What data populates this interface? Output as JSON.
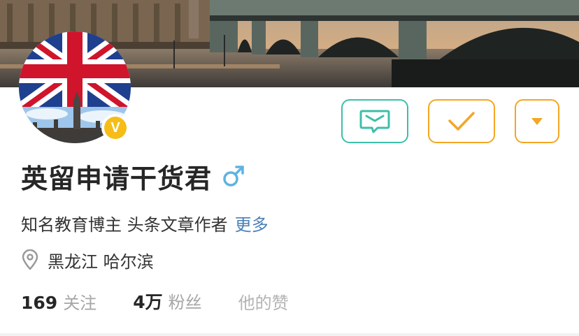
{
  "profile": {
    "name": "英留申请干货君",
    "gender_icon": "male-icon",
    "verified_badge": "V",
    "bio": "知名教育博主 头条文章作者",
    "bio_more": "更多",
    "location": "黑龙江 哈尔滨"
  },
  "stats": {
    "following_count": "169",
    "following_label": "关注",
    "fans_count": "4万",
    "fans_label": "粉丝",
    "likes_label": "他的赞"
  },
  "actions": {
    "message_icon": "message-icon",
    "follow_icon": "checkmark-icon",
    "more_icon": "caret-down-icon"
  },
  "colors": {
    "message_accent": "#3cbfa9",
    "follow_accent": "#f4a623",
    "link_blue": "#4a7fb8",
    "verified_gold": "#f6bd16",
    "gender_blue": "#5fb3e0"
  }
}
